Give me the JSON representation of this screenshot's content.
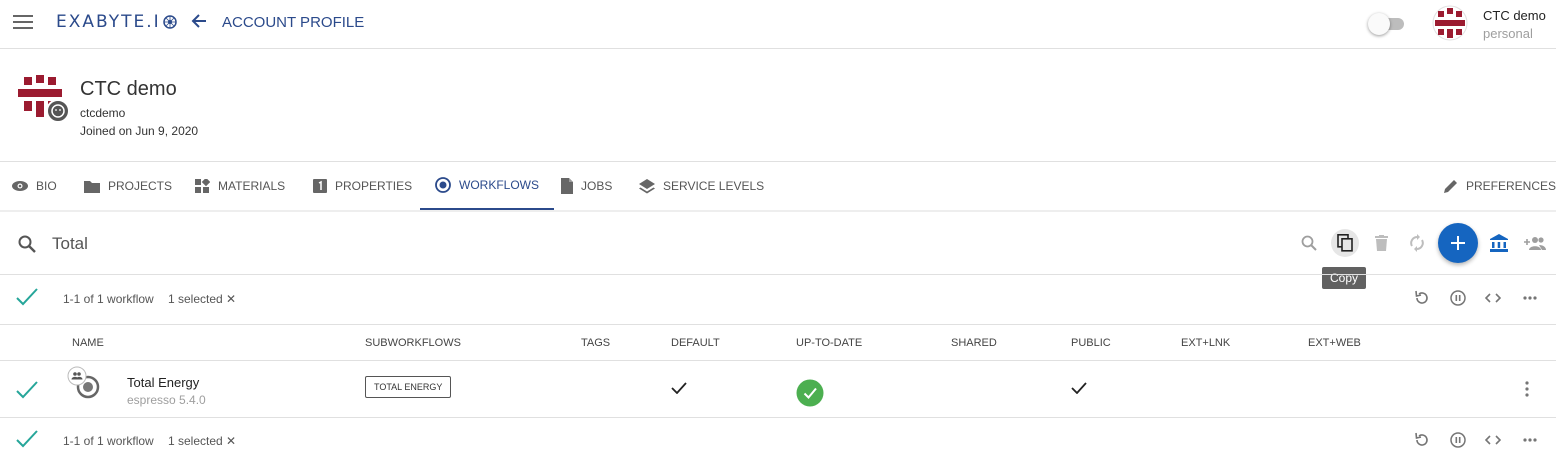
{
  "topbar": {
    "brand": "EXABYTE.I",
    "page_title": "ACCOUNT PROFILE",
    "user_name": "CTC demo",
    "user_plan": "personal"
  },
  "profile": {
    "name": "CTC demo",
    "username": "ctcdemo",
    "joined": "Joined on Jun 9, 2020"
  },
  "tabs": [
    {
      "label": "BIO",
      "icon": "eye-icon"
    },
    {
      "label": "PROJECTS",
      "icon": "folder-icon"
    },
    {
      "label": "MATERIALS",
      "icon": "materials-icon"
    },
    {
      "label": "PROPERTIES",
      "icon": "properties-icon"
    },
    {
      "label": "WORKFLOWS",
      "icon": "workflow-icon",
      "active": true
    },
    {
      "label": "JOBS",
      "icon": "document-icon"
    },
    {
      "label": "SERVICE LEVELS",
      "icon": "layers-icon"
    }
  ],
  "preferences_label": "PREFERENCES",
  "search": {
    "value": "Total"
  },
  "tooltip": "Copy",
  "status": {
    "count": "1-1 of 1 workflow",
    "selected": "1 selected ✕"
  },
  "table": {
    "headers": [
      "NAME",
      "SUBWORKFLOWS",
      "TAGS",
      "DEFAULT",
      "UP-TO-DATE",
      "SHARED",
      "PUBLIC",
      "EXT+LNK",
      "EXT+WEB"
    ],
    "rows": [
      {
        "name": "Total Energy",
        "app": "espresso 5.4.0",
        "subworkflow": "TOTAL ENERGY",
        "default": true,
        "up_to_date": true,
        "public": true
      }
    ]
  },
  "colors": {
    "accent": "#2b4a8b",
    "fab": "#1565c0",
    "check": "#26a69a",
    "ok": "#4caf50",
    "avatar": "#9b1b30"
  }
}
